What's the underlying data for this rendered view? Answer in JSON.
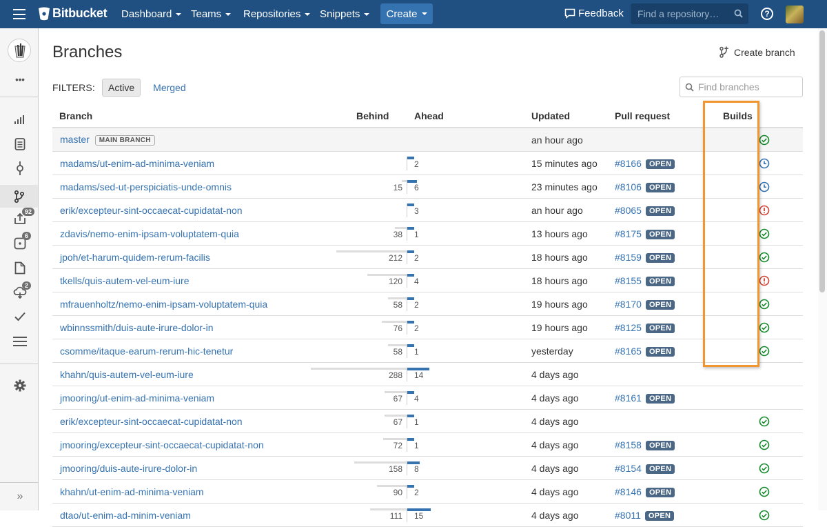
{
  "topnav": {
    "brand": "Bitbucket",
    "items": [
      "Dashboard",
      "Teams",
      "Repositories",
      "Snippets"
    ],
    "create_label": "Create",
    "feedback_label": "Feedback",
    "search_placeholder": "Find a repository…",
    "help_label": "?"
  },
  "sidebar": {
    "more_label": "•••",
    "badges": {
      "pullrequests": "92",
      "issues": "6",
      "pipelines": "2"
    },
    "collapse_label": "»"
  },
  "page": {
    "title": "Branches",
    "create_branch_label": "Create branch",
    "filters_label": "FILTERS:",
    "filter_active": "Active",
    "filter_merged": "Merged",
    "find_placeholder": "Find branches"
  },
  "table": {
    "headers": {
      "branch": "Branch",
      "behind": "Behind",
      "ahead": "Ahead",
      "updated": "Updated",
      "pull_request": "Pull request",
      "builds": "Builds"
    },
    "main_branch_badge": "MAIN BRANCH",
    "open_label": "OPEN",
    "rows": [
      {
        "name": "master",
        "main": true,
        "behind": null,
        "ahead": null,
        "updated": "an hour ago",
        "pr": null,
        "build": "success"
      },
      {
        "name": "madams/ut-enim-ad-minima-veniam",
        "behind": null,
        "ahead": 2,
        "updated": "15 minutes ago",
        "pr": "#8166",
        "build": "inprogress"
      },
      {
        "name": "madams/sed-ut-perspiciatis-unde-omnis",
        "behind": 15,
        "ahead": 6,
        "updated": "23 minutes ago",
        "pr": "#8106",
        "build": "inprogress"
      },
      {
        "name": "erik/excepteur-sint-occaecat-cupidatat-non",
        "behind": null,
        "ahead": 3,
        "updated": "an hour ago",
        "pr": "#8065",
        "build": "failed"
      },
      {
        "name": "zdavis/nemo-enim-ipsam-voluptatem-quia",
        "behind": 38,
        "ahead": 1,
        "updated": "13 hours ago",
        "pr": "#8175",
        "build": "success"
      },
      {
        "name": "jpoh/et-harum-quidem-rerum-facilis",
        "behind": 212,
        "ahead": 2,
        "updated": "18 hours ago",
        "pr": "#8159",
        "build": "success"
      },
      {
        "name": "tkells/quis-autem-vel-eum-iure",
        "behind": 120,
        "ahead": 4,
        "updated": "18 hours ago",
        "pr": "#8155",
        "build": "failed"
      },
      {
        "name": "mfrauenholtz/nemo-enim-ipsam-voluptatem-quia",
        "behind": 58,
        "ahead": 2,
        "updated": "19 hours ago",
        "pr": "#8170",
        "build": "success"
      },
      {
        "name": "wbinnssmith/duis-aute-irure-dolor-in",
        "behind": 76,
        "ahead": 2,
        "updated": "19 hours ago",
        "pr": "#8125",
        "build": "success"
      },
      {
        "name": "csomme/itaque-earum-rerum-hic-tenetur",
        "behind": 58,
        "ahead": 1,
        "updated": "yesterday",
        "pr": "#8165",
        "build": "success"
      },
      {
        "name": "khahn/quis-autem-vel-eum-iure",
        "behind": 288,
        "ahead": 14,
        "updated": "4 days ago",
        "pr": null,
        "build": null
      },
      {
        "name": "jmooring/ut-enim-ad-minima-veniam",
        "behind": 67,
        "ahead": 4,
        "updated": "4 days ago",
        "pr": "#8161",
        "build": null
      },
      {
        "name": "erik/excepteur-sint-occaecat-cupidatat-non",
        "behind": 67,
        "ahead": 1,
        "updated": "4 days ago",
        "pr": null,
        "build": "success"
      },
      {
        "name": "jmooring/excepteur-sint-occaecat-cupidatat-non",
        "behind": 72,
        "ahead": 1,
        "updated": "4 days ago",
        "pr": "#8158",
        "build": "success"
      },
      {
        "name": "jmooring/duis-aute-irure-dolor-in",
        "behind": 158,
        "ahead": 8,
        "updated": "4 days ago",
        "pr": "#8154",
        "build": "success"
      },
      {
        "name": "khahn/ut-enim-ad-minima-veniam",
        "behind": 90,
        "ahead": 2,
        "updated": "4 days ago",
        "pr": "#8146",
        "build": "success"
      },
      {
        "name": "dtao/ut-enim-ad-minim-veniam",
        "behind": 111,
        "ahead": 15,
        "updated": "4 days ago",
        "pr": "#8011",
        "build": "success"
      }
    ]
  },
  "colors": {
    "header_bg": "#205081",
    "link": "#3572b0",
    "success": "#14892c",
    "failed": "#d04437",
    "inprogress": "#3572b0",
    "highlight": "#f0952f"
  }
}
